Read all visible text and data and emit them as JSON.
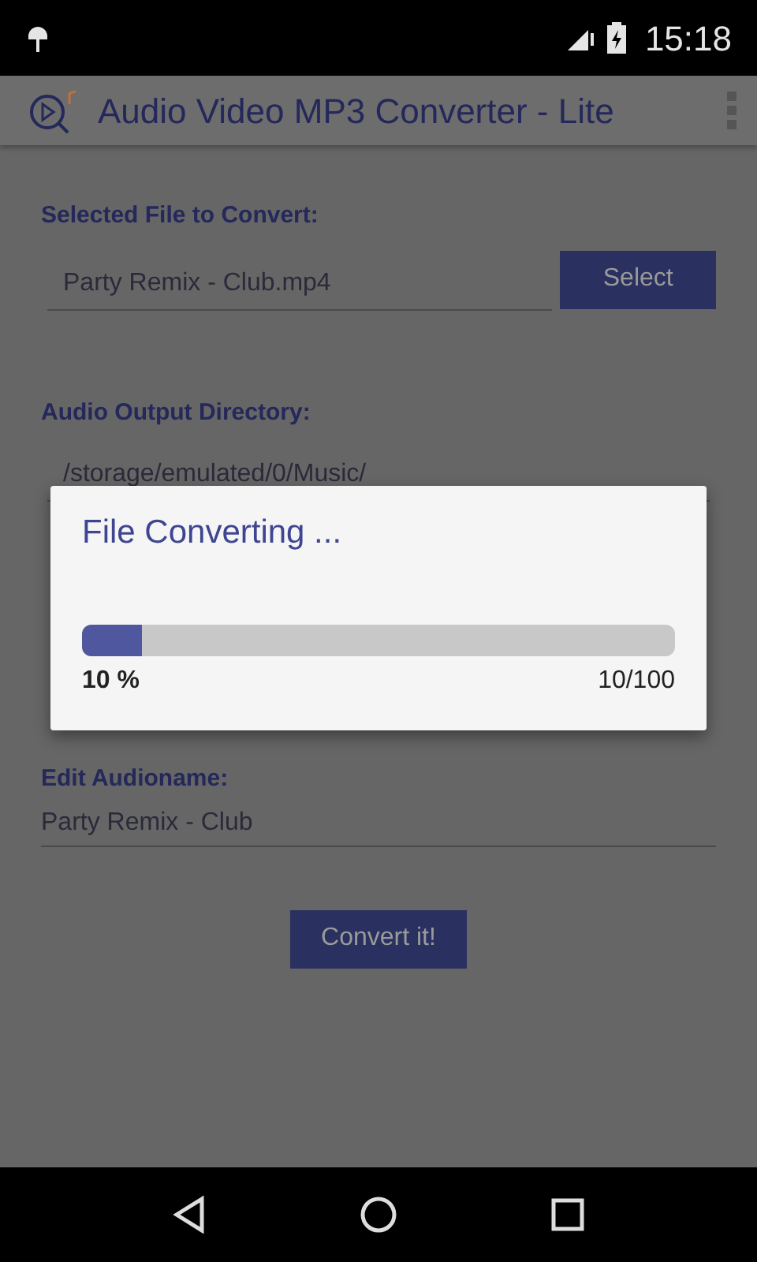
{
  "status_bar": {
    "time": "15:18"
  },
  "app_bar": {
    "title": "Audio Video MP3 Converter - Lite"
  },
  "form": {
    "file_label": "Selected File to Convert:",
    "file_value": "Party Remix - Club.mp4",
    "select_button": "Select",
    "output_label": "Audio Output Directory:",
    "output_value": "/storage/emulated/0/Music/",
    "name_label": "Edit Audioname:",
    "name_value": "Party Remix - Club",
    "convert_button": "Convert it!"
  },
  "dialog": {
    "title": "File Converting ...",
    "level": 0.1,
    "percent": "10 %",
    "count": "10/100"
  }
}
